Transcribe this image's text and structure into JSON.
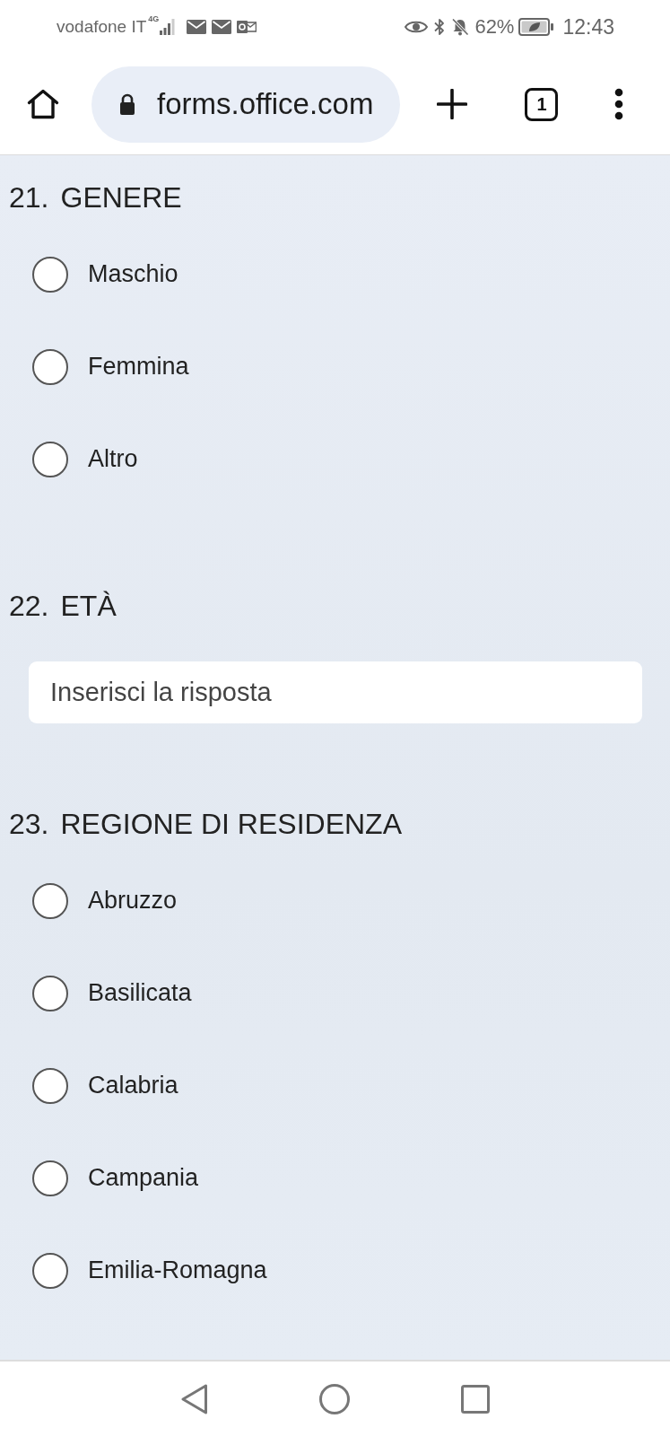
{
  "status_bar": {
    "carrier": "vodafone IT",
    "network_type": "4G",
    "battery": "62%",
    "time": "12:43"
  },
  "browser_bar": {
    "url": "forms.office.com",
    "tab_count": "1"
  },
  "questions": [
    {
      "number": "21.",
      "title": "GENERE",
      "kind": "choice",
      "options": [
        {
          "label": "Maschio",
          "selected": false
        },
        {
          "label": "Femmina",
          "selected": false
        },
        {
          "label": "Altro",
          "selected": false
        }
      ]
    },
    {
      "number": "22.",
      "title": "ETÀ",
      "kind": "text",
      "placeholder": "Inserisci la risposta"
    },
    {
      "number": "23.",
      "title": "REGIONE DI RESIDENZA",
      "kind": "choice",
      "options": [
        {
          "label": "Abruzzo",
          "selected": false
        },
        {
          "label": "Basilicata",
          "selected": false
        },
        {
          "label": "Calabria",
          "selected": false
        },
        {
          "label": "Campania",
          "selected": false
        },
        {
          "label": "Emilia-Romagna",
          "selected": false
        }
      ]
    }
  ]
}
